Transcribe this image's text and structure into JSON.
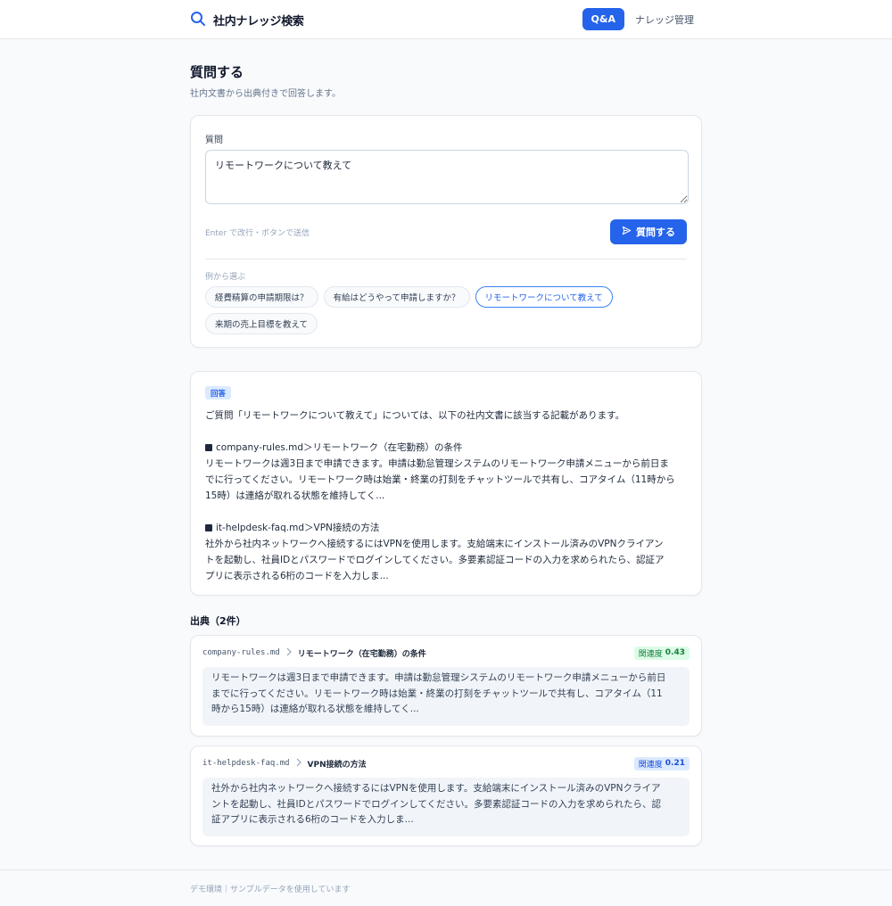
{
  "header": {
    "app_title": "社内ナレッジ検索",
    "nav": {
      "qa": "Q&A",
      "knowledge": "ナレッジ管理"
    }
  },
  "page": {
    "title": "質問する",
    "subtitle": "社内文書から出典付きで回答します。"
  },
  "question_form": {
    "label": "質問",
    "input_value": "リモートワークについて教えて",
    "hint": "Enter で改行・ボタンで送信",
    "submit_label": "質問する",
    "examples_label": "例から選ぶ",
    "examples": [
      "経費精算の申請期限は？",
      "有給はどうやって申請しますか？",
      "リモートワークについて教えて",
      "来期の売上目標を教えて"
    ],
    "selected_example": "リモートワークについて教えて"
  },
  "answer": {
    "badge": "回答",
    "intro": "ご質問「リモートワークについて教えて」については、以下の社内文書に該当する記載があります。",
    "sections": [
      {
        "heading": "company-rules.md＞リモートワーク（在宅勤務）の条件",
        "lines": [
          "リモートワークは週3日まで申請できます。申請は勤怠管理システムのリモートワーク申請メニューから前日ま",
          "でに行ってください。リモートワーク時は始業・終業の打刻をチャットツールで共有し、コアタイム（11時から",
          "15時）は連絡が取れる状態を維持してく..."
        ]
      },
      {
        "heading": "it-helpdesk-faq.md＞VPN接続の方法",
        "lines": [
          "社外から社内ネットワークへ接続するにはVPNを使用します。支給端末にインストール済みのVPNクライアン",
          "トを起動し、社員IDとパスワードでログインしてください。多要素認証コードの入力を求められたら、認証ア",
          "プリに表示される6桁のコードを入力しま..."
        ]
      }
    ]
  },
  "sources": {
    "title": "出典（2件）",
    "items": [
      {
        "file": "company-rules.md",
        "section": "リモートワーク（在宅勤務）の条件",
        "score_label": "関連度",
        "score": "0.43",
        "score_color": "#15803d",
        "lines": [
          "リモートワークは週3日まで申請できます。申請は勤怠管理システムのリモートワーク申請メニューから前日",
          "までに行ってください。リモートワーク時は始業・終業の打刻をチャットツールで共有し、コアタイム（11",
          "時から15時）は連絡が取れる状態を維持してく..."
        ]
      },
      {
        "file": "it-helpdesk-faq.md",
        "section": "VPN接続の方法",
        "score_label": "関連度",
        "score": "0.21",
        "score_color": "#1d4ed8",
        "lines": [
          "社外から社内ネットワークへ接続するにはVPNを使用します。支給端末にインストール済みのVPNクライア",
          "ントを起動し、社員IDとパスワードでログインしてください。多要素認証コードの入力を求められたら、認",
          "証アプリに表示される6桁のコードを入力しま..."
        ]
      }
    ]
  },
  "footer": {
    "text": "デモ環境｜サンプルデータを使用しています"
  },
  "colors": {
    "accent": "#2563eb",
    "background": "#f8fafc"
  },
  "icons": {
    "brand": "search-icon",
    "submit": "send-icon",
    "separator": "chevron-right-icon",
    "bullet": "square-bullet-icon"
  }
}
